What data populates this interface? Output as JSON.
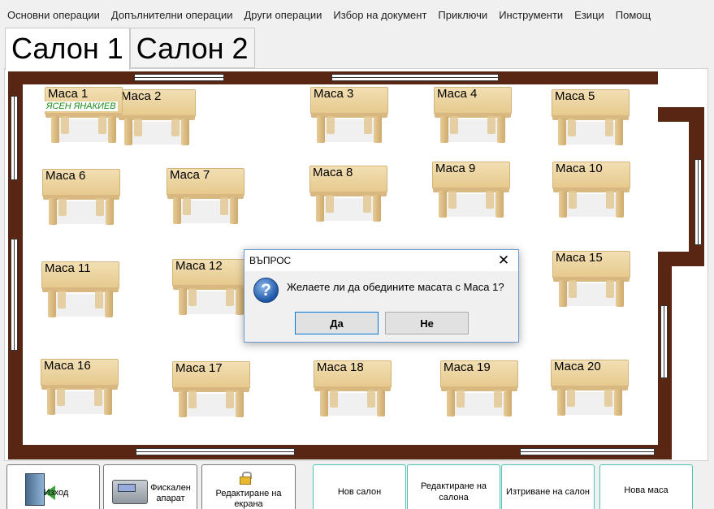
{
  "menu": [
    "Основни операции",
    "Допълнителни операции",
    "Други операции",
    "Избор на документ",
    "Приключи",
    "Инструменти",
    "Езици",
    "Помощ"
  ],
  "tabs": [
    {
      "label": "Салон 1",
      "active": true
    },
    {
      "label": "Салон 2",
      "active": false
    }
  ],
  "tables": [
    {
      "label": "Маса 1",
      "waiter": "ЯСЕН ЯНАКИЕВ"
    },
    {
      "label": "Маса 2"
    },
    {
      "label": "Маса 3"
    },
    {
      "label": "Маса 4"
    },
    {
      "label": "Маса 5"
    },
    {
      "label": "Маса 6"
    },
    {
      "label": "Маса 7"
    },
    {
      "label": "Маса 8"
    },
    {
      "label": "Маса 9"
    },
    {
      "label": "Маса 10"
    },
    {
      "label": "Маса 11"
    },
    {
      "label": "Маса 12"
    },
    {
      "label": "Маса 15"
    },
    {
      "label": "Маса 16"
    },
    {
      "label": "Маса 17"
    },
    {
      "label": "Маса 18"
    },
    {
      "label": "Маса 19"
    },
    {
      "label": "Маса 20"
    }
  ],
  "dialog": {
    "title": "ВЪПРОС",
    "message": "Желаете ли да обедините масата с Маса 1?",
    "yes": "Да",
    "no": "Не",
    "icon": "question-icon"
  },
  "toolbar": {
    "exit": "Изход",
    "fiscal_line1": "Фискален",
    "fiscal_line2": "апарат",
    "edit_screen_line1": "Редактиране на",
    "edit_screen_line2": "екрана",
    "new_hall": "Нов салон",
    "edit_hall_line1": "Редактиране на",
    "edit_hall_line2": "салона",
    "delete_hall": "Изтриване на салон",
    "new_table": "Нова маса"
  },
  "colors": {
    "wall": "#5a2614",
    "waiter_text": "#1d8a1d",
    "dialog_border": "#6b9bd1"
  }
}
